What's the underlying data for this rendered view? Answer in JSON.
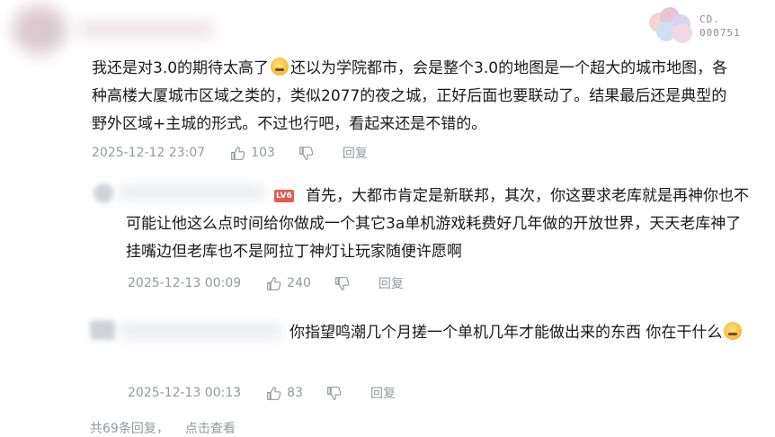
{
  "badge": {
    "code": "CD.\n000751",
    "icon": "fan-badge-icon"
  },
  "main_comment": {
    "text_a": "我还是对3.0的期待太高了",
    "text_b": "还以为学院都市，会是整个3.0的地图是一个超大的城市地图，各种高楼大厦城市区域之类的，类似2077的夜之城，正好后面也要联动了。结果最后还是典型的野外区域+主城的形式。不过也行吧，看起来还是不错的。",
    "time": "2025-12-12 23:07",
    "likes": "103",
    "reply_label": "回复"
  },
  "replies": [
    {
      "level": "LV6",
      "text": "首先，大都市肯定是新联邦，其次，你这要求老库就是再神你也不可能让他这么点时间给你做成一个其它3a单机游戏耗费好几年做的开放世界，天天老库神了挂嘴边但老库也不是阿拉丁神灯让玩家随便许愿啊",
      "time": "2025-12-13 00:09",
      "likes": "240",
      "reply_label": "回复"
    },
    {
      "text": "你指望鸣潮几个月搓一个单机几年才能做出来的东西 你在干什么",
      "time": "2025-12-13 00:13",
      "likes": "83",
      "reply_label": "回复"
    }
  ],
  "more": {
    "count_text": "共69条回复，",
    "link_text": "点击查看"
  }
}
